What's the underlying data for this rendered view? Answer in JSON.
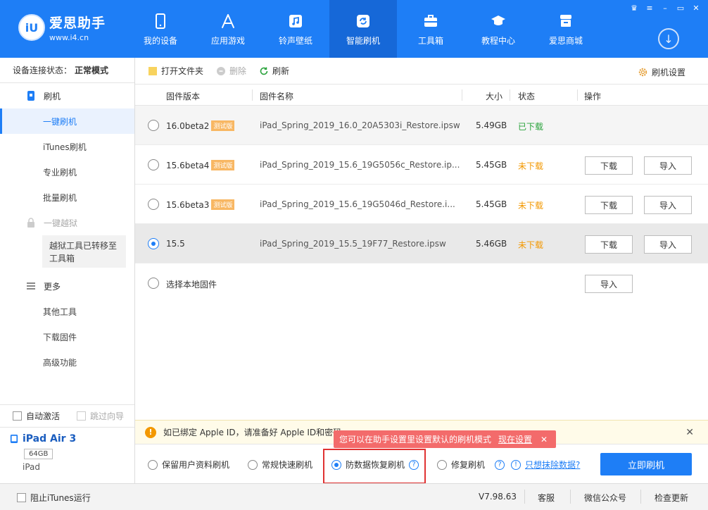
{
  "app": {
    "logo_badge": "iU",
    "logo_title": "爱思助手",
    "logo_sub": "www.i4.cn"
  },
  "nav": [
    {
      "label": "我的设备",
      "icon": "phone-icon"
    },
    {
      "label": "应用游戏",
      "icon": "appstore-icon"
    },
    {
      "label": "铃声壁纸",
      "icon": "music-icon"
    },
    {
      "label": "智能刷机",
      "icon": "refresh-icon"
    },
    {
      "label": "工具箱",
      "icon": "toolbox-icon"
    },
    {
      "label": "教程中心",
      "icon": "graduation-cap-icon"
    },
    {
      "label": "爱思商城",
      "icon": "shop-icon"
    }
  ],
  "sidebar": {
    "status_label": "设备连接状态：",
    "status_value": "正常模式",
    "flash_group": "刷机",
    "items": [
      "一键刷机",
      "iTunes刷机",
      "专业刷机",
      "批量刷机"
    ],
    "jailbreak_group": "一键越狱",
    "jailbreak_note": "越狱工具已转移至工具箱",
    "more_group": "更多",
    "more_items": [
      "其他工具",
      "下载固件",
      "高级功能"
    ],
    "auto_activate": "自动激活",
    "skip_guide": "跳过向导"
  },
  "device": {
    "name": "iPad Air 3",
    "capacity": "64GB",
    "type": "iPad"
  },
  "toolbar": {
    "open_folder": "打开文件夹",
    "delete": "删除",
    "refresh": "刷新",
    "settings": "刷机设置"
  },
  "table": {
    "headers": [
      "固件版本",
      "固件名称",
      "大小",
      "状态",
      "操作"
    ],
    "beta_tag": "测试版",
    "download_btn": "下载",
    "import_btn": "导入",
    "rows": [
      {
        "version": "16.0beta2",
        "beta": true,
        "name": "iPad_Spring_2019_16.0_20A5303i_Restore.ipsw",
        "size": "5.49GB",
        "status": "已下载",
        "downloaded": true
      },
      {
        "version": "15.6beta4",
        "beta": true,
        "name": "iPad_Spring_2019_15.6_19G5056c_Restore.ip...",
        "size": "5.45GB",
        "status": "未下载",
        "downloaded": false
      },
      {
        "version": "15.6beta3",
        "beta": true,
        "name": "iPad_Spring_2019_15.6_19G5046d_Restore.i...",
        "size": "5.45GB",
        "status": "未下载",
        "downloaded": false
      },
      {
        "version": "15.5",
        "beta": false,
        "name": "iPad_Spring_2019_15.5_19F77_Restore.ipsw",
        "size": "5.46GB",
        "status": "未下载",
        "downloaded": false
      }
    ],
    "local_label": "选择本地固件"
  },
  "notice": {
    "text": "如已绑定 Apple ID，请准备好 Apple ID和密码",
    "tip_text": "您可以在助手设置里设置默认的刷机模式",
    "tip_link": "现在设置"
  },
  "modes": {
    "keep_data": "保留用户资料刷机",
    "quick": "常规快速刷机",
    "anti_loss": "防数据恢复刷机",
    "repair": "修复刷机",
    "erase_link": "只想抹除数据?",
    "flash_now": "立即刷机"
  },
  "statusbar": {
    "block_itunes": "阻止iTunes运行",
    "version": "V7.98.63",
    "service": "客服",
    "wechat": "微信公众号",
    "update": "检查更新"
  },
  "colors": {
    "brand": "#1e7ef6",
    "downloaded": "#2aa33c",
    "not_downloaded": "#f39800",
    "tip_bg": "#f36b6b"
  }
}
